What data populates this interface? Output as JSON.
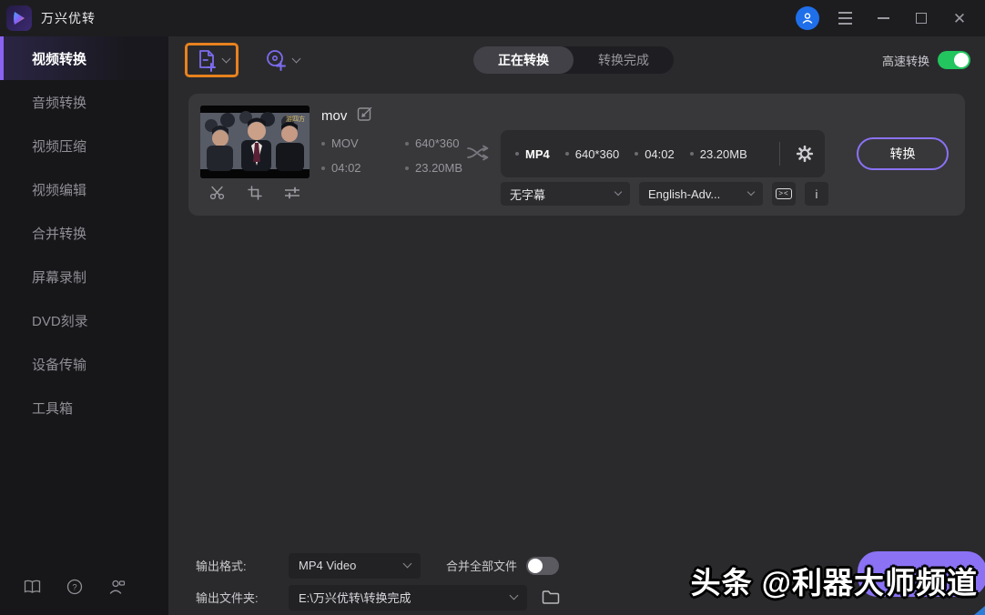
{
  "colors": {
    "accent_purple": "#7c6cf0",
    "highlight_orange": "#e8821e",
    "toggle_green": "#22c55e",
    "avatar_blue": "#1f6feb",
    "watermark_purple": "#8b72f5"
  },
  "titlebar": {
    "app_title": "万兴优转"
  },
  "sidebar": {
    "items": [
      {
        "label": "视频转换",
        "active": true
      },
      {
        "label": "音频转换",
        "active": false
      },
      {
        "label": "视频压缩",
        "active": false
      },
      {
        "label": "视频编辑",
        "active": false
      },
      {
        "label": "合并转换",
        "active": false
      },
      {
        "label": "屏幕录制",
        "active": false
      },
      {
        "label": "DVD刻录",
        "active": false
      },
      {
        "label": "设备传输",
        "active": false
      },
      {
        "label": "工具箱",
        "active": false
      }
    ]
  },
  "toolbar": {
    "tab_converting": "正在转换",
    "tab_finished": "转换完成",
    "high_speed_label": "高速转换",
    "high_speed_on": true
  },
  "file_card": {
    "name": "mov",
    "source": {
      "format": "MOV",
      "resolution": "640*360",
      "duration": "04:02",
      "size": "23.20MB"
    },
    "target": {
      "format": "MP4",
      "resolution": "640*360",
      "duration": "04:02",
      "size": "23.20MB"
    },
    "subtitle_select": "无字幕",
    "audio_select": "English-Adv...",
    "cc_glyph": "><",
    "info_glyph": "i",
    "convert_label": "转换"
  },
  "bottom_bar": {
    "output_format_label": "输出格式:",
    "output_format_value": "MP4 Video",
    "merge_label": "合并全部文件",
    "merge_on": false,
    "output_folder_label": "输出文件夹:",
    "output_folder_value": "E:\\万兴优转\\转换完成"
  },
  "watermark": {
    "text": "头条 @利器大师频道"
  }
}
